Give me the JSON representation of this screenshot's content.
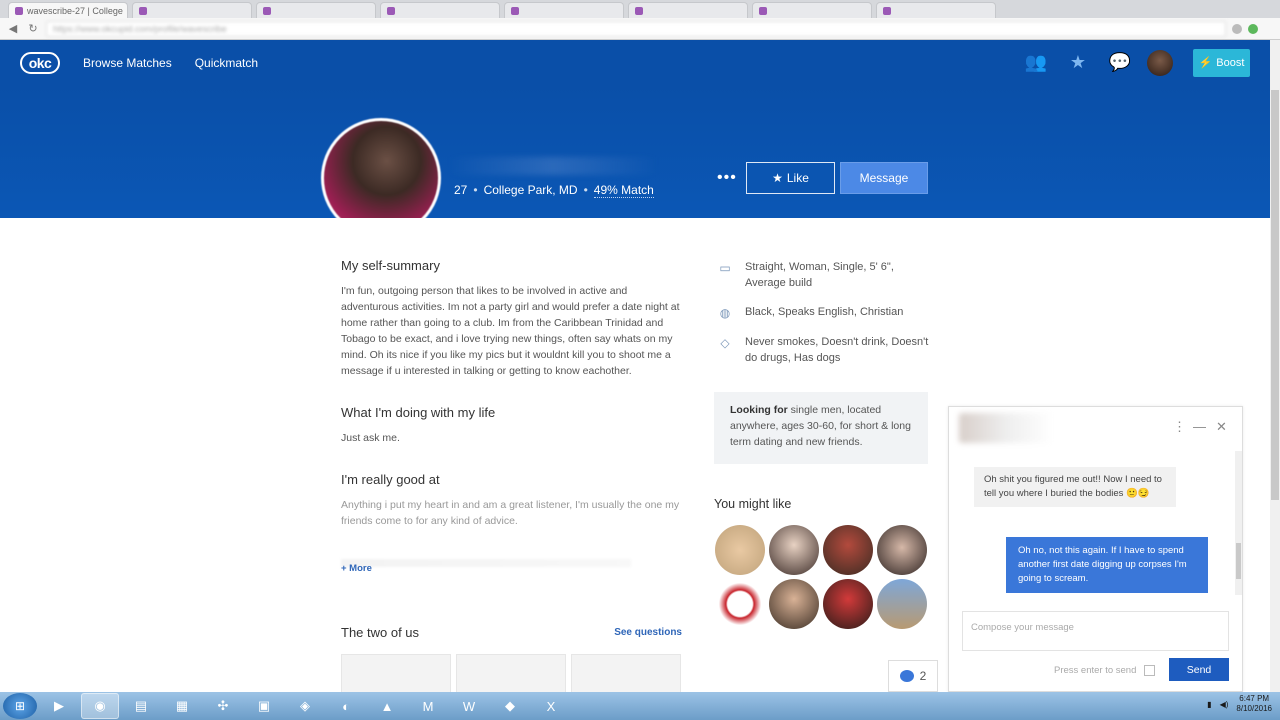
{
  "browser": {
    "tabs": [
      "wavescribe-27 | College",
      "blurred tab",
      "blurred tab",
      "blurred tab",
      "blurred tab",
      "blurred tab",
      "blurred tab",
      "blurred tab"
    ],
    "url": "https://www.okcupid.com/profile/wavescribe"
  },
  "nav": {
    "logo": "okc",
    "browse": "Browse Matches",
    "quickmatch": "Quickmatch",
    "boost": "Boost"
  },
  "profile": {
    "age": "27",
    "location": "College Park, MD",
    "match": "49% Match",
    "like_label": "Like",
    "message_label": "Message",
    "more": "•••"
  },
  "essays": [
    {
      "title": "My self-summary",
      "text": "I'm fun, outgoing person that likes to be involved in active and adventurous activities. Im not a party girl and would prefer a date night at home rather than going to a club. Im from the Caribbean Trinidad and Tobago to be exact, and i love trying new things, often say whats on my mind. Oh its nice if you like my pics but it wouldnt kill you to shoot me a message if u interested in talking or getting to know eachother."
    },
    {
      "title": "What I'm doing with my life",
      "text": "Just ask me."
    },
    {
      "title": "I'm really good at",
      "text": "Anything i put my heart in and am a great listener, I'm usually the one my friends come to for any kind of advice."
    }
  ],
  "more_link": "+ More",
  "two_of_us": {
    "title": "The two of us",
    "see": "See questions"
  },
  "details": [
    {
      "icon": "id-card-icon",
      "text": "Straight, Woman, Single, 5' 6\", Average build"
    },
    {
      "icon": "globe-icon",
      "text": "Black, Speaks English, Christian"
    },
    {
      "icon": "tag-icon",
      "text": "Never smokes, Doesn't drink, Doesn't do drugs, Has dogs"
    }
  ],
  "looking": {
    "label": "Looking for",
    "text": "single men, located anywhere, ages 30-60, for short & long term dating and new friends."
  },
  "you_might_like": "You might like",
  "chat": {
    "incoming": "Oh shit you figured me out!! Now I need to tell you where I buried the bodies 🙂😏",
    "outgoing": "Oh no, not this again. If I have to spend another first date digging up corpses I'm going to scream.",
    "placeholder": "Compose your message",
    "enter_label": "Press enter to send",
    "send": "Send"
  },
  "message_count": "2",
  "clock": {
    "time": "6:47 PM",
    "date": "8/10/2016"
  },
  "colors": {
    "nav": "#0a4fa8",
    "boost": "#2bb7d8",
    "message_btn": "#4c89e6",
    "send": "#1e5cbf"
  }
}
